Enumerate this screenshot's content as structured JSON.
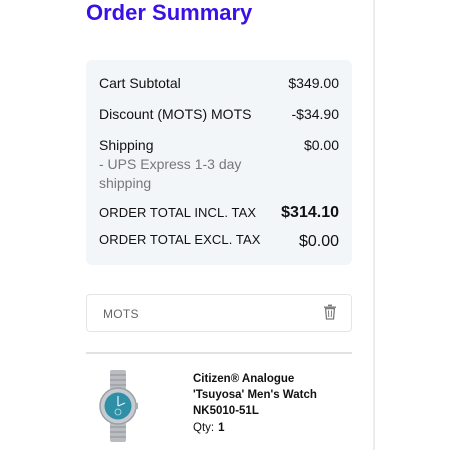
{
  "page": {
    "title": "Order Summary"
  },
  "summary": {
    "subtotal_label": "Cart Subtotal",
    "subtotal_value": "$349.00",
    "discount_label": "Discount (MOTS) MOTS",
    "discount_value": "-$34.90",
    "shipping_label": "Shipping",
    "shipping_method_line1": "- UPS Express 1-3 day",
    "shipping_method_line2": "shipping",
    "shipping_value": "$0.00",
    "total_incl_label": "ORDER TOTAL INCL. TAX",
    "total_incl_value": "$314.10",
    "total_excl_label": "ORDER TOTAL EXCL. TAX",
    "total_excl_value": "$0.00"
  },
  "coupon": {
    "code": "MOTS",
    "remove_icon": "trash-icon"
  },
  "item": {
    "name": "Citizen® Analogue 'Tsuyosa' Men's Watch NK5010-51L",
    "qty_label": "Qty:",
    "qty_value": "1",
    "dial_color": "#2f8fa6"
  },
  "colors": {
    "accent": "#3b10e6",
    "panel_bg": "#f3f6f9"
  }
}
